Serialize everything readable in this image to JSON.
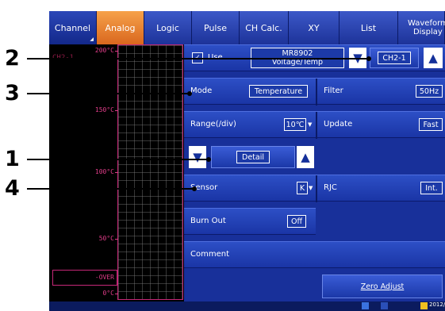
{
  "tabs": [
    {
      "label": "Channel",
      "state": "selected"
    },
    {
      "label": "Analog",
      "state": "active"
    },
    {
      "label": "Logic"
    },
    {
      "label": "Pulse"
    },
    {
      "label": "CH Calc."
    },
    {
      "label": "XY"
    },
    {
      "label": "List"
    },
    {
      "label": "Waveform\nDisplay"
    }
  ],
  "graph": {
    "channel_label": "CH2-1",
    "ticks": [
      "200°C",
      "150°C",
      "100°C",
      "50°C",
      "-OVER",
      "0°C"
    ],
    "trace_color": "#e23d8a"
  },
  "panel": {
    "use_label": "Use",
    "module_name": "MR8902",
    "module_type": "Voltage/Temp",
    "channel": "CH2-1",
    "mode_label": "Mode",
    "mode_value": "Temperature",
    "filter_label": "Filter",
    "filter_value": "50Hz",
    "range_label": "Range(/div)",
    "range_value": "10℃",
    "update_label": "Update",
    "update_value": "Fast",
    "detail_label": "Detail",
    "sensor_label": "Sensor",
    "sensor_value": "K",
    "rjc_label": "RJC",
    "rjc_value": "Int.",
    "burnout_label": "Burn Out",
    "burnout_value": "Off",
    "comment_label": "Comment",
    "zero_adjust_label": "Zero Adjust"
  },
  "callouts": [
    "2",
    "3",
    "1",
    "4"
  ],
  "status_bar": {
    "date": "2012/0"
  },
  "colors": {
    "tab_active": "#e8832e",
    "panel_blue": "#1a35a6",
    "trace": "#e23d8a"
  }
}
